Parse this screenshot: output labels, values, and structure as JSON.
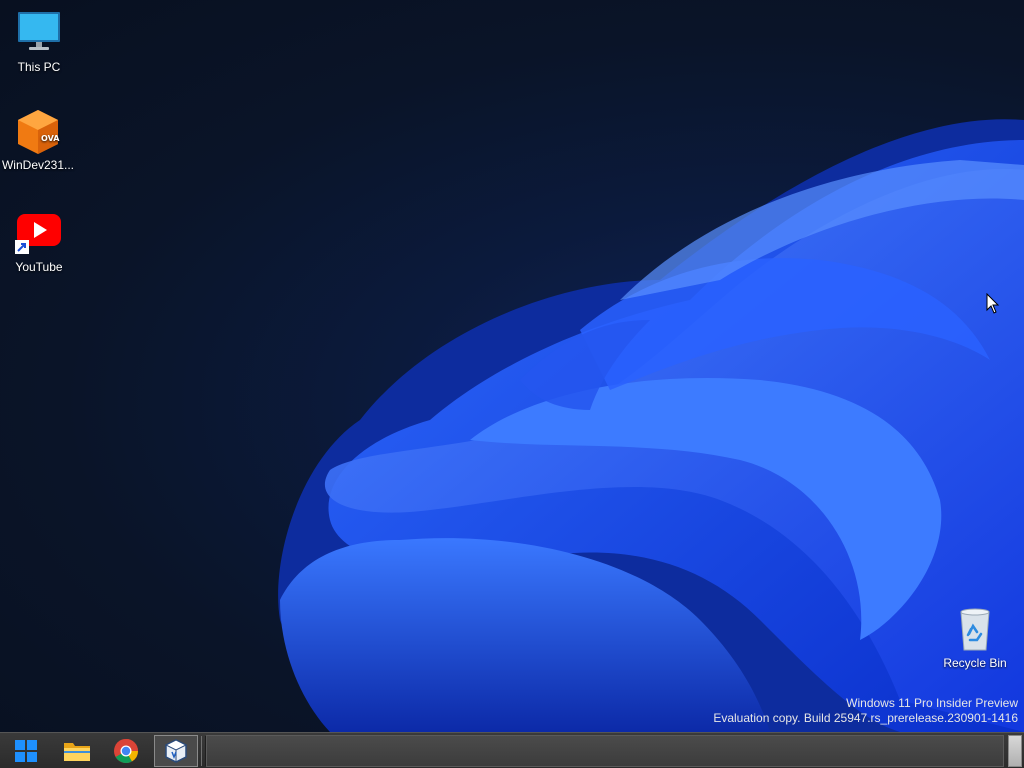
{
  "desktop": {
    "icons": [
      {
        "label": "This PC",
        "icon": "monitor-icon"
      },
      {
        "label": "WinDev231...",
        "icon": "ova-package-icon"
      },
      {
        "label": "YouTube",
        "icon": "youtube-icon"
      },
      {
        "label": "Recycle Bin",
        "icon": "recycle-bin-icon"
      }
    ],
    "watermark": {
      "line1": "Windows 11 Pro Insider Preview",
      "line2": "Evaluation copy. Build 25947.rs_prerelease.230901-1416"
    },
    "ova_badge": "OVA"
  },
  "taskbar": {
    "buttons": [
      {
        "name": "start",
        "icon": "windows-logo-icon"
      },
      {
        "name": "file-explorer",
        "icon": "folder-icon"
      },
      {
        "name": "chrome",
        "icon": "chrome-icon"
      },
      {
        "name": "virtualbox",
        "icon": "virtualbox-icon",
        "active": true
      }
    ]
  },
  "colors": {
    "accent_blue": "#1a4cff",
    "desktop_bg": "#0a1428",
    "taskbar_bg": "#2b2b2b"
  }
}
